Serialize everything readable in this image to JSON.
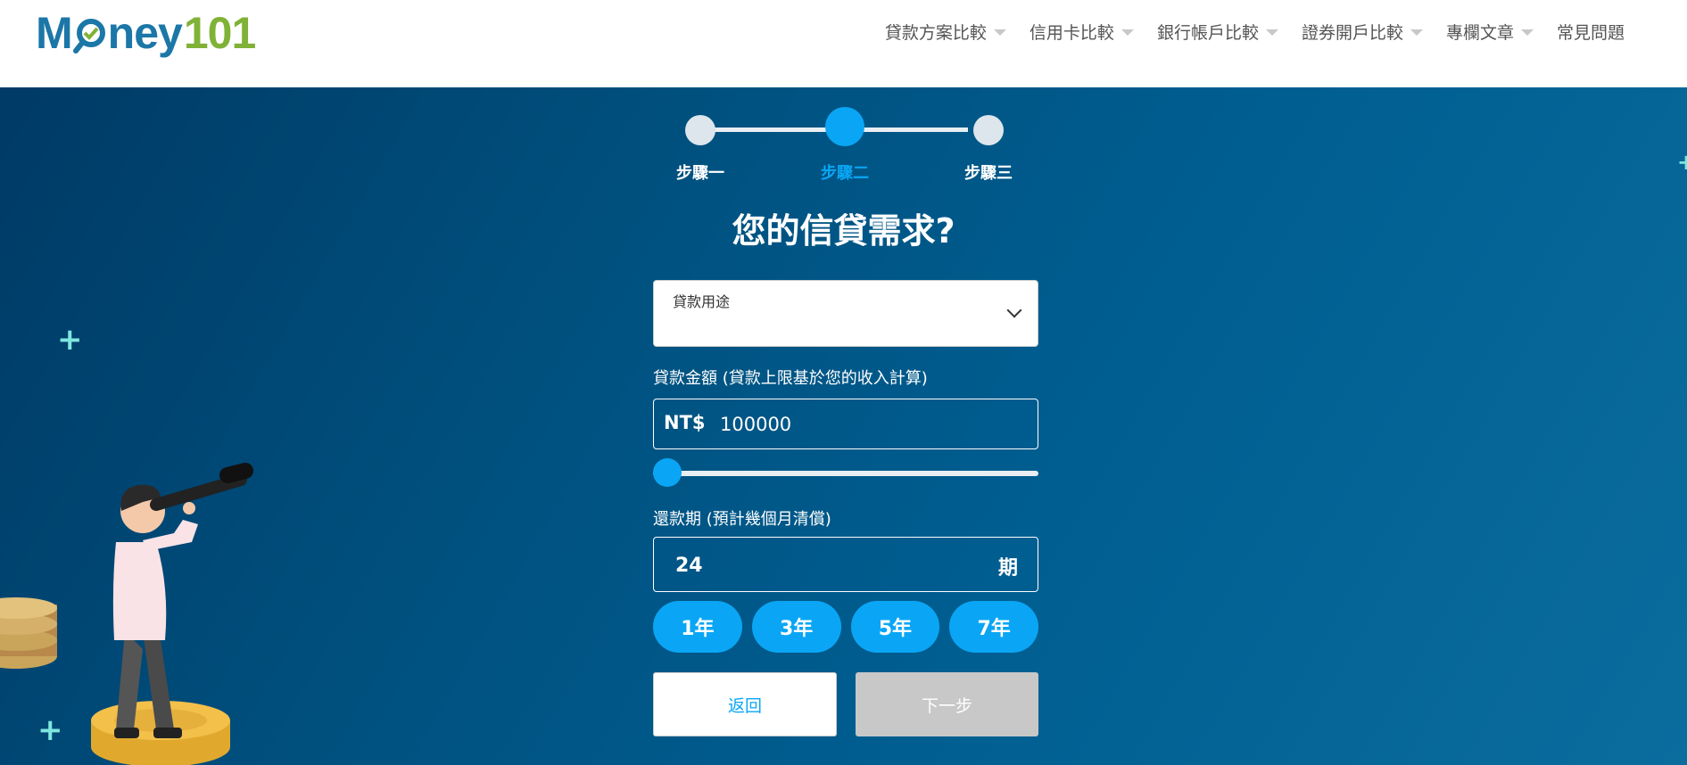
{
  "logo": {
    "part1": "M",
    "part2": "ney",
    "part3": "101"
  },
  "nav": {
    "items": [
      {
        "label": "貸款方案比較",
        "has_caret": true
      },
      {
        "label": "信用卡比較",
        "has_caret": true
      },
      {
        "label": "銀行帳戶比較",
        "has_caret": true
      },
      {
        "label": "證券開戶比較",
        "has_caret": true
      },
      {
        "label": "專欄文章",
        "has_caret": true
      },
      {
        "label": "常見問題",
        "has_caret": false
      }
    ]
  },
  "stepper": {
    "steps": [
      "步驟一",
      "步驟二",
      "步驟三"
    ],
    "active_index": 1
  },
  "form": {
    "title": "您的信貸需求?",
    "purpose": {
      "label": "貸款用途",
      "value": ""
    },
    "amount": {
      "label": "貸款金額 (貸款上限基於您的收入計算)",
      "prefix": "NT$",
      "value": "100000",
      "slider_fraction": 0
    },
    "term": {
      "label": "還款期 (預計幾個月清償)",
      "value": "24",
      "unit": "期"
    },
    "quick_terms": [
      "1年",
      "3年",
      "5年",
      "7年"
    ],
    "back_label": "返回",
    "next_label": "下一步"
  },
  "colors": {
    "accent": "#0aa6f5",
    "logo_blue": "#1b77a7",
    "logo_green": "#7fb236",
    "disabled": "#c8c8c8"
  }
}
